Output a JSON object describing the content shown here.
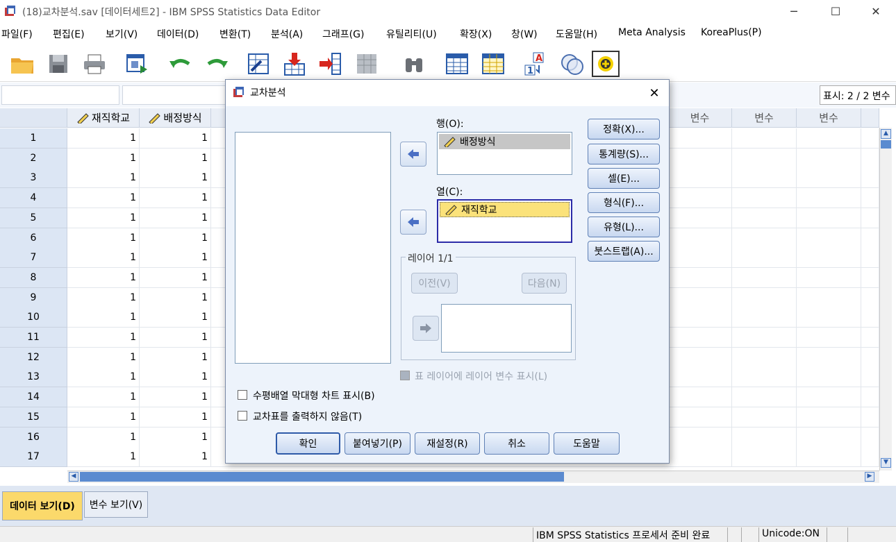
{
  "window": {
    "title": "(18)교차분석.sav [데이터세트2] - IBM SPSS Statistics Data Editor",
    "minimize": "─",
    "maximize": "☐",
    "close": "✕"
  },
  "menu": [
    "파일(F)",
    "편집(E)",
    "보기(V)",
    "데이터(D)",
    "변환(T)",
    "분석(A)",
    "그래프(G)",
    "유틸리티(U)",
    "확장(X)",
    "창(W)",
    "도움말(H)",
    "Meta Analysis",
    "KoreaPlus(P)"
  ],
  "toolbar_icons": [
    "open-folder-icon",
    "save-icon",
    "print-icon",
    "dialog-recall-icon",
    "undo-icon",
    "redo-icon",
    "goto-case-icon",
    "insert-case-icon",
    "insert-variable-icon",
    "split-file-icon",
    "find-icon",
    "data-table-icon",
    "grid-table-icon",
    "value-labels-icon",
    "use-sets-icon",
    "add-on-icon"
  ],
  "display_count": "표시: 2 / 2 변수",
  "grid": {
    "columns": [
      {
        "name": "재직학교",
        "icon": "scale-ruler-icon"
      },
      {
        "name": "배정방식",
        "icon": "scale-ruler-icon"
      }
    ],
    "empty_col_label": "변수",
    "rows": [
      {
        "n": "1",
        "a": "1",
        "b": "1"
      },
      {
        "n": "2",
        "a": "1",
        "b": "1"
      },
      {
        "n": "3",
        "a": "1",
        "b": "1"
      },
      {
        "n": "4",
        "a": "1",
        "b": "1"
      },
      {
        "n": "5",
        "a": "1",
        "b": "1"
      },
      {
        "n": "6",
        "a": "1",
        "b": "1"
      },
      {
        "n": "7",
        "a": "1",
        "b": "1"
      },
      {
        "n": "8",
        "a": "1",
        "b": "1"
      },
      {
        "n": "9",
        "a": "1",
        "b": "1"
      },
      {
        "n": "10",
        "a": "1",
        "b": "1"
      },
      {
        "n": "11",
        "a": "1",
        "b": "1"
      },
      {
        "n": "12",
        "a": "1",
        "b": "1"
      },
      {
        "n": "13",
        "a": "1",
        "b": "1"
      },
      {
        "n": "14",
        "a": "1",
        "b": "1"
      },
      {
        "n": "15",
        "a": "1",
        "b": "1"
      },
      {
        "n": "16",
        "a": "1",
        "b": "1"
      },
      {
        "n": "17",
        "a": "1",
        "b": "1"
      }
    ]
  },
  "tabs": {
    "data_view": "데이터 보기(D)",
    "variable_view": "변수 보기(V)"
  },
  "status": {
    "processor": "IBM SPSS Statistics 프로세서 준비 완료",
    "unicode": "Unicode:ON"
  },
  "dialog": {
    "title": "교차분석",
    "rows_label": "행(O):",
    "rows_item": "배정방식",
    "cols_label": "열(C):",
    "cols_item": "재직학교",
    "layer_label": "레이어 1/1",
    "prev_btn": "이전(V)",
    "next_btn": "다음(N)",
    "layer_display_chk": "표 레이어에 레이어 변수 표시(L)",
    "bar_chart_chk": "수평배열 막대형 차트 표시(B)",
    "suppress_chk": "교차표를 출력하지 않음(T)",
    "side_buttons": [
      "정확(X)...",
      "통계량(S)...",
      "셀(E)...",
      "형식(F)...",
      "유형(L)...",
      "붓스트랩(A)..."
    ],
    "ok": "확인",
    "paste": "붙여넣기(P)",
    "reset": "재설정(R)",
    "cancel": "취소",
    "help": "도움말"
  }
}
